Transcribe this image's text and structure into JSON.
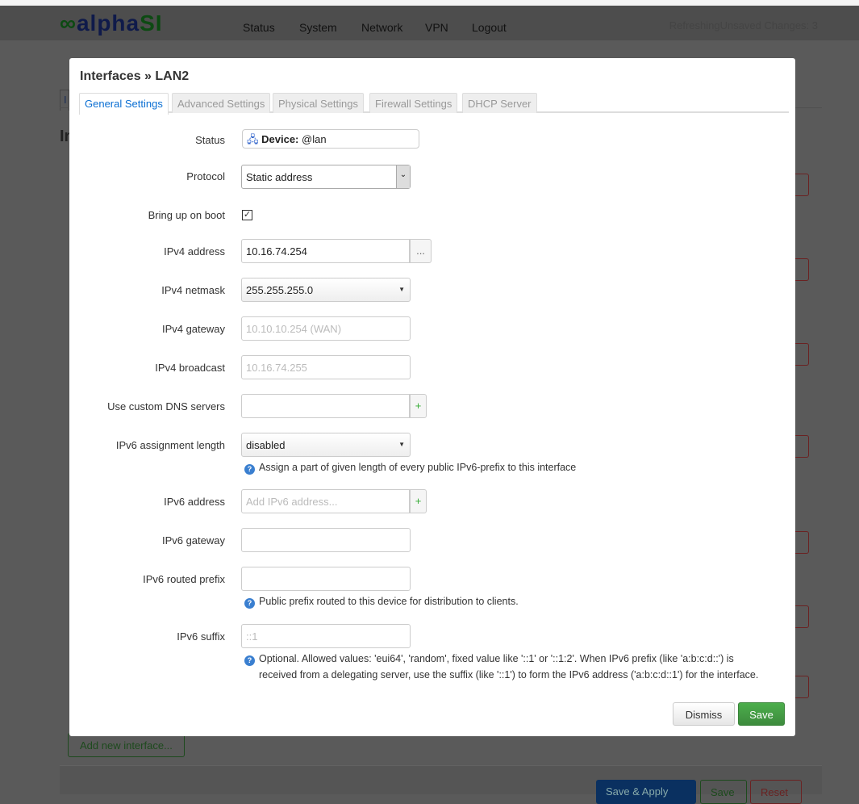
{
  "header": {
    "logo_left": "alpha",
    "logo_right": "SI",
    "nav": [
      "Status",
      "System",
      "Network",
      "VPN",
      "Logout"
    ],
    "status": "RefreshingUnsaved Changes: 3"
  },
  "background": {
    "tab_fragment": "I",
    "heading_fragment": "In",
    "add_interface": "Add new interface...",
    "save_apply": "Save & Apply",
    "save": "Save",
    "reset": "Reset"
  },
  "modal": {
    "title": "Interfaces » LAN2",
    "tabs": [
      "General Settings",
      "Advanced Settings",
      "Physical Settings",
      "Firewall Settings",
      "DHCP Server"
    ],
    "fields": {
      "status": {
        "label": "Status",
        "prefix": "Device:",
        "value": "@lan"
      },
      "protocol": {
        "label": "Protocol",
        "value": "Static address"
      },
      "boot": {
        "label": "Bring up on boot",
        "checked": true
      },
      "ipv4_addr": {
        "label": "IPv4 address",
        "value": "10.16.74.254",
        "addon": "..."
      },
      "ipv4_mask": {
        "label": "IPv4 netmask",
        "value": "255.255.255.0"
      },
      "ipv4_gw": {
        "label": "IPv4 gateway",
        "placeholder": "10.10.10.254 (WAN)"
      },
      "ipv4_bc": {
        "label": "IPv4 broadcast",
        "placeholder": "10.16.74.255"
      },
      "dns": {
        "label": "Use custom DNS servers",
        "value": "",
        "addon": "+"
      },
      "ipv6_assign": {
        "label": "IPv6 assignment length",
        "value": "disabled",
        "help": "Assign a part of given length of every public IPv6-prefix to this interface"
      },
      "ipv6_addr": {
        "label": "IPv6 address",
        "placeholder": "Add IPv6 address...",
        "addon": "+"
      },
      "ipv6_gw": {
        "label": "IPv6 gateway",
        "value": ""
      },
      "ipv6_prefix": {
        "label": "IPv6 routed prefix",
        "value": "",
        "help": "Public prefix routed to this device for distribution to clients."
      },
      "ipv6_suffix": {
        "label": "IPv6 suffix",
        "placeholder": "::1",
        "help1": "Optional. Allowed values: 'eui64', 'random', fixed value like '::1' or '::1:2'. When IPv6 prefix (like 'a:b:c:d::') is",
        "help2": "received from a delegating server, use the suffix (like '::1') to form the IPv6 address ('a:b:c:d::1') for the interface."
      }
    },
    "dismiss": "Dismiss",
    "save": "Save"
  }
}
